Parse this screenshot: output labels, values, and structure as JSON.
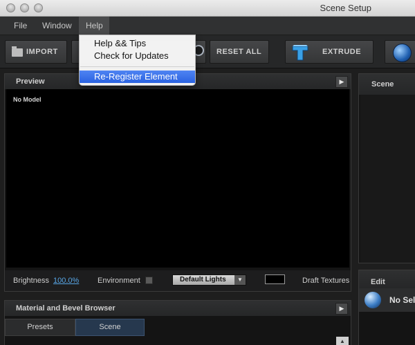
{
  "window": {
    "title": "Scene Setup"
  },
  "menubar": {
    "items": [
      "File",
      "Window",
      "Help"
    ]
  },
  "help_menu": {
    "items": [
      "Help && Tips",
      "Check for Updates",
      "Re-Register Element"
    ],
    "highlighted": "Re-Register Element"
  },
  "toolbar": {
    "import_label": "IMPORT",
    "reset_label": "RESET ALL",
    "extrude_label": "EXTRUDE"
  },
  "preview": {
    "title": "Preview",
    "status": "No Model",
    "brightness_label": "Brightness",
    "brightness_value": "100.0%",
    "environment_label": "Environment",
    "lights_value": "Default Lights",
    "draft_label": "Draft Textures"
  },
  "material": {
    "title": "Material and Bevel Browser",
    "tabs": [
      "Presets",
      "Scene"
    ],
    "active_tab": "Scene"
  },
  "scene": {
    "title": "Scene"
  },
  "edit": {
    "title": "Edit",
    "selection": "No Sel"
  },
  "colors": {
    "accent": "#2a62e0",
    "link": "#58a6e6",
    "background": "#1e1e1e"
  }
}
